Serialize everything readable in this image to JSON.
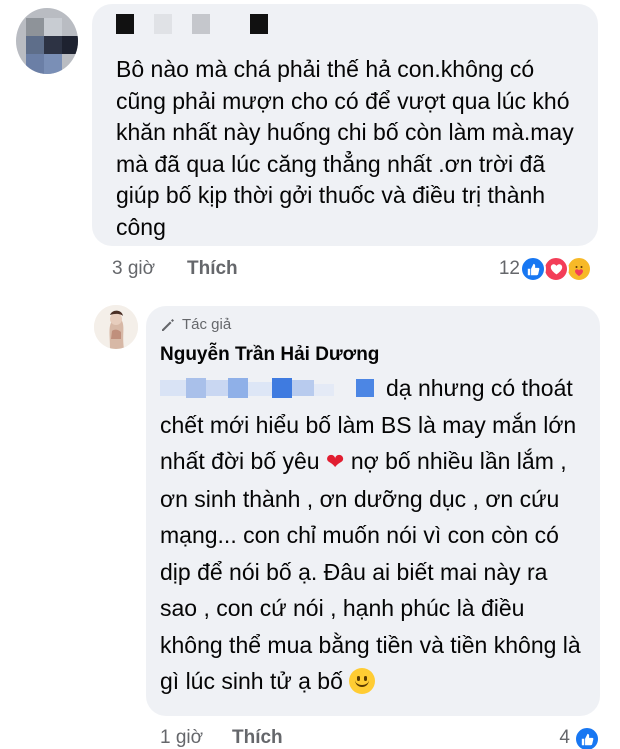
{
  "comment": {
    "text": "Bô nào mà chá phải thế hả con.không có cũng phải mượn cho có để vượt qua lúc khó khăn nhất này huống chi bố còn làm mà.may mà đã qua lúc căng thẳng nhất .ơn trời đã giúp bố kịp thời gởi thuốc và điều trị thành công",
    "time": "3 giờ",
    "like_label": "Thích",
    "reaction_count": "12",
    "reaction_icons": [
      "like-icon",
      "love-icon",
      "care-icon"
    ]
  },
  "reply": {
    "author_badge": "Tác giả",
    "author_name": "Nguyễn Trần Hải Dương",
    "text_after_tag": "dạ nhưng có thoát chết mới hiểu bố làm BS là may mắn lớn nhất đời bố yêu",
    "text_rest": "nợ bố nhiều lần lắm , ơn sinh thành , ơn dưỡng dục , ơn cứu mạng... con chỉ muốn nói vì con còn có dịp để nói bố ạ. Đâu ai biết mai này ra sao , con cứ nói , hạnh phúc là điều không thể mua bằng tiền và tiền không là gì lúc sinh tử ạ bố",
    "time": "1 giờ",
    "like_label": "Thích",
    "reaction_count": "4",
    "reaction_icons": [
      "like-icon"
    ]
  },
  "colors": {
    "bubble": "#eff1f5",
    "meta_text": "#65676b",
    "like_blue": "#1877f2",
    "love_red": "#f33e58",
    "care_yellow": "#f7b928"
  }
}
